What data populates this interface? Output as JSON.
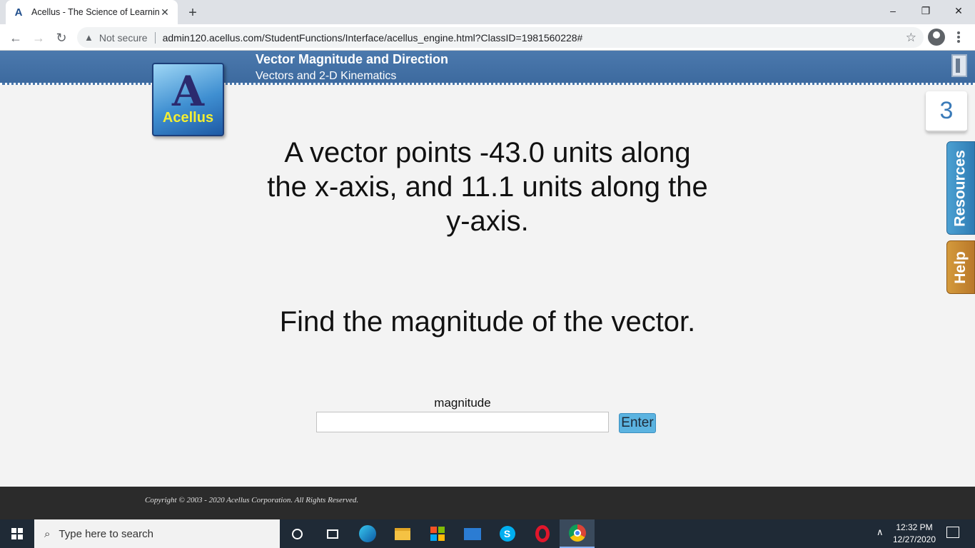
{
  "browser": {
    "tab_title": "Acellus - The Science of Learning",
    "close_glyph": "✕",
    "newtab_glyph": "+",
    "security_label": "Not secure",
    "url": "admin120.acellus.com/StudentFunctions/Interface/acellus_engine.html?ClassID=1981560228#"
  },
  "header": {
    "title": "Vector Magnitude and Direction",
    "subtitle": "Vectors and 2-D Kinematics"
  },
  "logo": {
    "letter": "A",
    "text": "Acellus"
  },
  "question": {
    "prompt": "A vector points -43.0 units along the x-axis, and 11.1 units along the y-axis.",
    "task": "Find the magnitude of the vector."
  },
  "answer": {
    "label": "magnitude",
    "value": "",
    "button": "Enter"
  },
  "side": {
    "counter": "3",
    "resources": "Resources",
    "help": "Help"
  },
  "footer": {
    "copyright": "Copyright © 2003 - 2020 Acellus Corporation.  All Rights Reserved."
  },
  "taskbar": {
    "search_placeholder": "Type here to search",
    "time": "12:32 PM",
    "date": "12/27/2020"
  },
  "colors": {
    "header": "#4477aa",
    "enter_button": "#5bb3e0",
    "resources_tab": "#3a8cc6",
    "help_tab": "#c98a33"
  }
}
